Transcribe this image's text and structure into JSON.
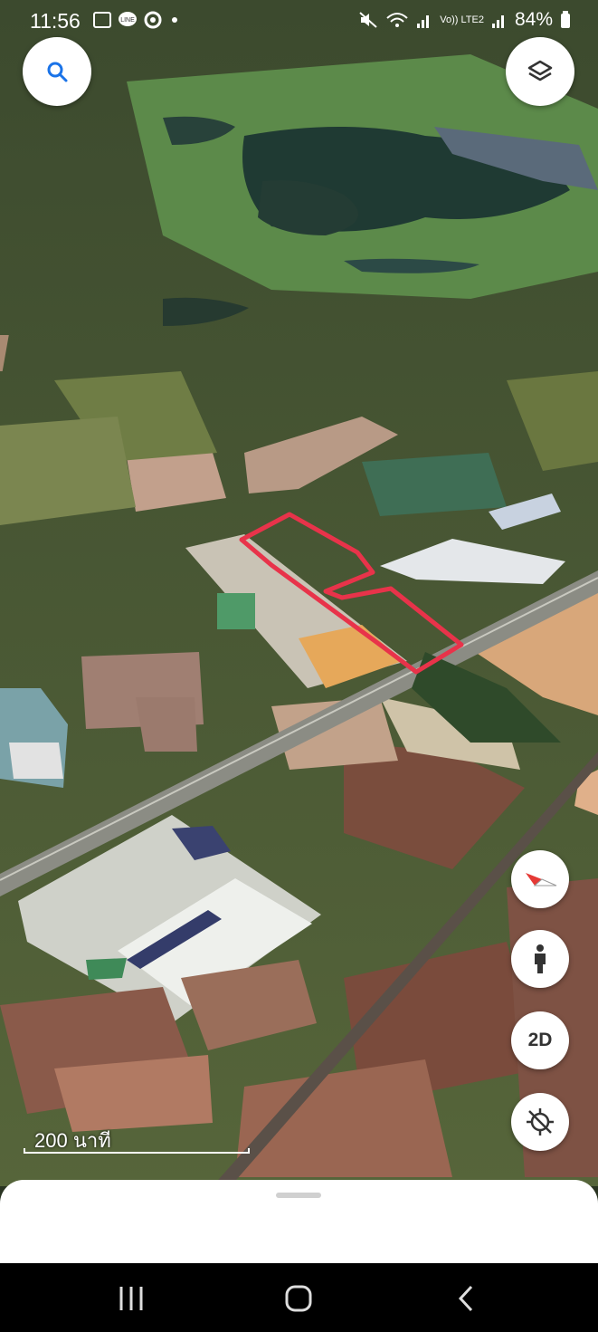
{
  "status_bar": {
    "time": "11:56",
    "battery": "84%",
    "network": "Vo)) LTE2",
    "left_icons": [
      "gallery-icon",
      "line-app-icon",
      "chrome-icon",
      "dot-icon"
    ],
    "right_icons": [
      "mute-icon",
      "wifi-icon",
      "signal-icon",
      "battery-icon"
    ]
  },
  "map": {
    "scale_label": "200 นาที",
    "highlight_color": "#e8334a",
    "view_mode_button": "2D"
  },
  "buttons": {
    "search": "search-icon",
    "layers": "layers-icon",
    "compass": "compass-icon",
    "street_view": "pegman-icon",
    "location": "location-off-icon"
  },
  "nav_bar": {
    "recent": "recent-apps-icon",
    "home": "home-icon",
    "back": "back-icon"
  }
}
